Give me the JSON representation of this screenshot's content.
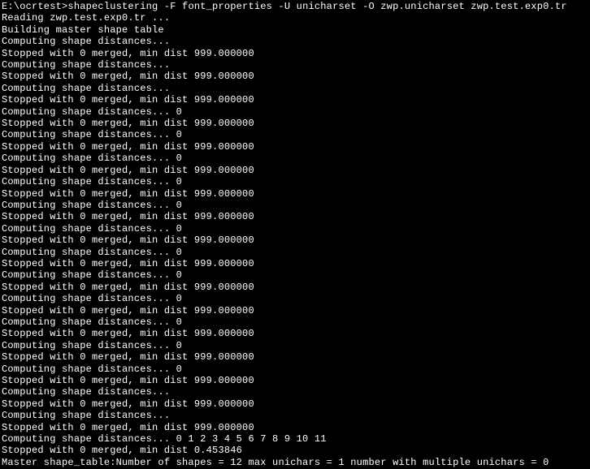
{
  "prompt": "E:\\ocrtest>",
  "command": "shapeclustering -F font_properties -U unicharset -O zwp.unicharset zwp.test.exp0.tr",
  "lines": [
    "Reading zwp.test.exp0.tr ...",
    "Building master shape table",
    "Computing shape distances...",
    "Stopped with 0 merged, min dist 999.000000",
    "Computing shape distances...",
    "Stopped with 0 merged, min dist 999.000000",
    "Computing shape distances...",
    "Stopped with 0 merged, min dist 999.000000",
    "Computing shape distances... 0",
    "Stopped with 0 merged, min dist 999.000000",
    "Computing shape distances... 0",
    "Stopped with 0 merged, min dist 999.000000",
    "Computing shape distances... 0",
    "Stopped with 0 merged, min dist 999.000000",
    "Computing shape distances... 0",
    "Stopped with 0 merged, min dist 999.000000",
    "Computing shape distances... 0",
    "Stopped with 0 merged, min dist 999.000000",
    "Computing shape distances... 0",
    "Stopped with 0 merged, min dist 999.000000",
    "Computing shape distances... 0",
    "Stopped with 0 merged, min dist 999.000000",
    "Computing shape distances... 0",
    "Stopped with 0 merged, min dist 999.000000",
    "Computing shape distances... 0",
    "Stopped with 0 merged, min dist 999.000000",
    "Computing shape distances... 0",
    "Stopped with 0 merged, min dist 999.000000",
    "Computing shape distances... 0",
    "Stopped with 0 merged, min dist 999.000000",
    "Computing shape distances... 0",
    "Stopped with 0 merged, min dist 999.000000",
    "Computing shape distances...",
    "Stopped with 0 merged, min dist 999.000000",
    "Computing shape distances...",
    "Stopped with 0 merged, min dist 999.000000",
    "Computing shape distances... 0 1 2 3 4 5 6 7 8 9 10 11",
    "Stopped with 0 merged, min dist 0.453846",
    "Master shape_table:Number of shapes = 12 max unichars = 1 number with multiple unichars = 0"
  ]
}
